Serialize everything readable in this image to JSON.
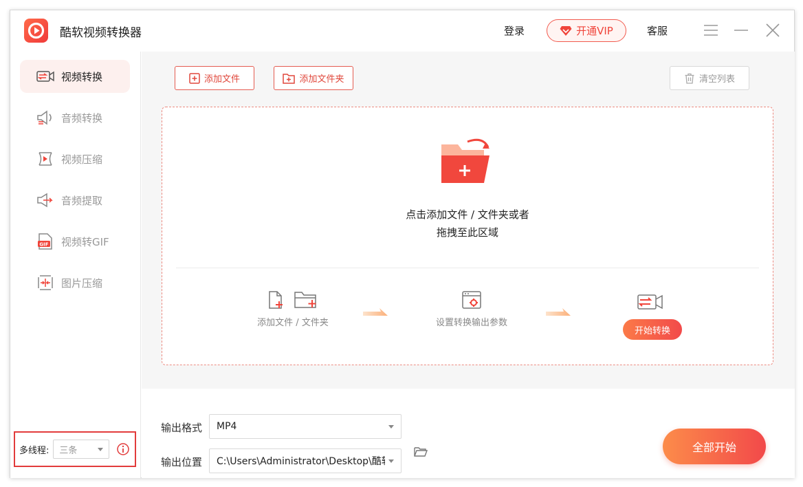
{
  "app": {
    "title": "酷软视频转换器"
  },
  "header": {
    "login": "登录",
    "vip": "开通VIP",
    "service": "客服"
  },
  "sidebar": {
    "items": [
      {
        "label": "视频转换",
        "icon": "video-convert-icon",
        "active": true
      },
      {
        "label": "音频转换",
        "icon": "audio-convert-icon",
        "active": false
      },
      {
        "label": "视频压缩",
        "icon": "video-compress-icon",
        "active": false
      },
      {
        "label": "音频提取",
        "icon": "audio-extract-icon",
        "active": false
      },
      {
        "label": "视频转GIF",
        "icon": "gif-icon",
        "active": false
      },
      {
        "label": "图片压缩",
        "icon": "image-compress-icon",
        "active": false
      }
    ],
    "threads": {
      "label": "多线程:",
      "value": "三条"
    }
  },
  "toolbar": {
    "add_file": "添加文件",
    "add_folder": "添加文件夹",
    "clear_list": "清空列表"
  },
  "dropzone": {
    "line1": "点击添加文件 / 文件夹或者",
    "line2": "拖拽至此区域",
    "steps": {
      "add": "添加文件 / 文件夹",
      "settings": "设置转换输出参数",
      "start": "开始转换"
    }
  },
  "output": {
    "format_label": "输出格式",
    "format_value": "MP4",
    "location_label": "输出位置",
    "location_value": "C:\\Users\\Administrator\\Desktop\\酷软"
  },
  "actions": {
    "start_all": "全部开始"
  },
  "colors": {
    "accent": "#f0443a",
    "accent_gradient_start": "#fc8c4a",
    "active_bg": "#fdf0ee"
  }
}
